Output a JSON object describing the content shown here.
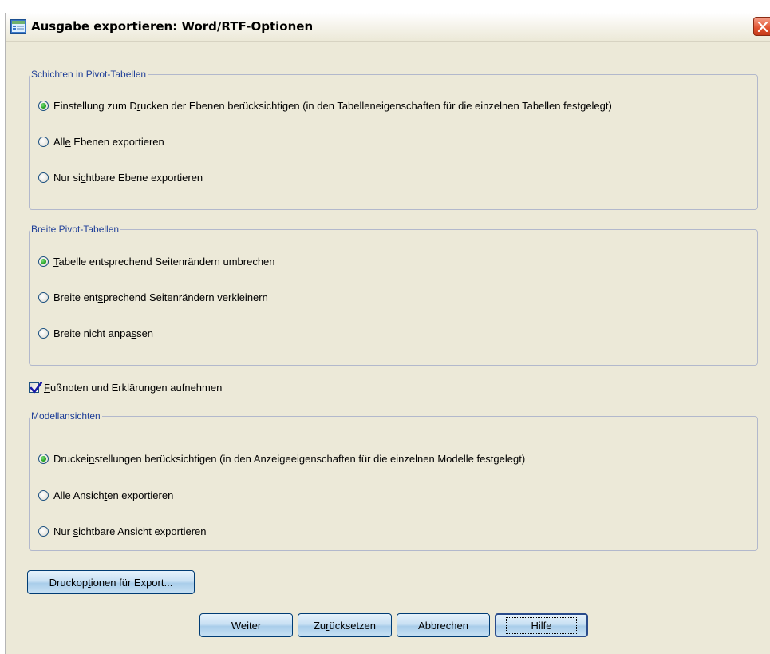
{
  "window": {
    "title": "Ausgabe exportieren: Word/RTF-Optionen"
  },
  "groups": {
    "layers": {
      "legend": "Schichten in Pivot-Tabellen",
      "options": [
        {
          "pre": "Einstellung zum D",
          "mn": "r",
          "post": "ucken der Ebenen berücksichtigen (in den Tabelleneigenschaften für die einzelnen Tabellen festgelegt)",
          "checked": true
        },
        {
          "pre": "All",
          "mn": "e",
          "post": " Ebenen exportieren",
          "checked": false
        },
        {
          "pre": "Nur si",
          "mn": "c",
          "post": "htbare Ebene exportieren",
          "checked": false
        }
      ]
    },
    "wide": {
      "legend": "Breite Pivot-Tabellen",
      "options": [
        {
          "pre": "",
          "mn": "T",
          "post": "abelle entsprechend Seitenrändern umbrechen",
          "checked": true
        },
        {
          "pre": "Breite ent",
          "mn": "s",
          "post": "prechend Seitenrändern verkleinern",
          "checked": false
        },
        {
          "pre": "Breite nicht anpa",
          "mn": "s",
          "post": "sen",
          "checked": false
        }
      ]
    },
    "models": {
      "legend": "Modellansichten",
      "options": [
        {
          "pre": "Druckei",
          "mn": "n",
          "post": "stellungen berücksichtigen (in den Anzeigeeigenschaften für die einzelnen Modelle festgelegt)",
          "checked": true
        },
        {
          "pre": "Alle Ansich",
          "mn": "t",
          "post": "en exportieren",
          "checked": false
        },
        {
          "pre": "Nur ",
          "mn": "s",
          "post": "ichtbare Ansicht exportieren",
          "checked": false
        }
      ]
    }
  },
  "footnotes": {
    "pre": "",
    "mn": "F",
    "post": "ußnoten und Erklärungen aufnehmen",
    "checked": true
  },
  "buttons": {
    "print_options": {
      "pre": "Druckop",
      "mn": "t",
      "post": "ionen für Export..."
    },
    "continue": {
      "pre": "Weiter",
      "mn": "",
      "post": ""
    },
    "reset": {
      "pre": "Zu",
      "mn": "r",
      "post": "ücksetzen"
    },
    "cancel": {
      "pre": "Abbrechen",
      "mn": "",
      "post": ""
    },
    "help": {
      "pre": "Hilfe",
      "mn": "",
      "post": ""
    }
  },
  "colors": {
    "dialog_bg": "#ece9d8",
    "legend_text": "#1f3f98",
    "group_border": "#b2b8cc",
    "button_border": "#003c74"
  }
}
